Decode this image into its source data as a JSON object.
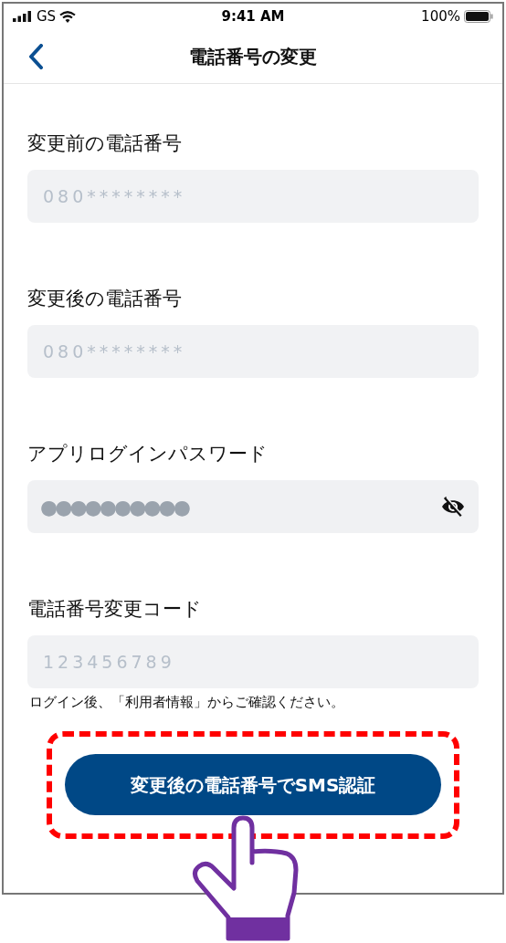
{
  "status_bar": {
    "carrier": "GS",
    "time": "9:41 AM",
    "battery": "100%"
  },
  "nav": {
    "title": "電話番号の変更"
  },
  "fields": [
    {
      "kind": "text",
      "label": "変更前の電話番号",
      "placeholder": "080********"
    },
    {
      "kind": "text",
      "label": "変更後の電話番号",
      "placeholder": "080********"
    },
    {
      "kind": "password",
      "label": "アプリログインパスワード",
      "value": "●●●●●●●●●●",
      "revealed": false
    },
    {
      "kind": "text",
      "label": "電話番号変更コード",
      "placeholder": "123456789",
      "hint": "ログイン後、「利用者情報」からご確認ください。"
    }
  ],
  "submit_button": {
    "label": "変更後の電話番号でSMS認証",
    "highlighted": true
  }
}
